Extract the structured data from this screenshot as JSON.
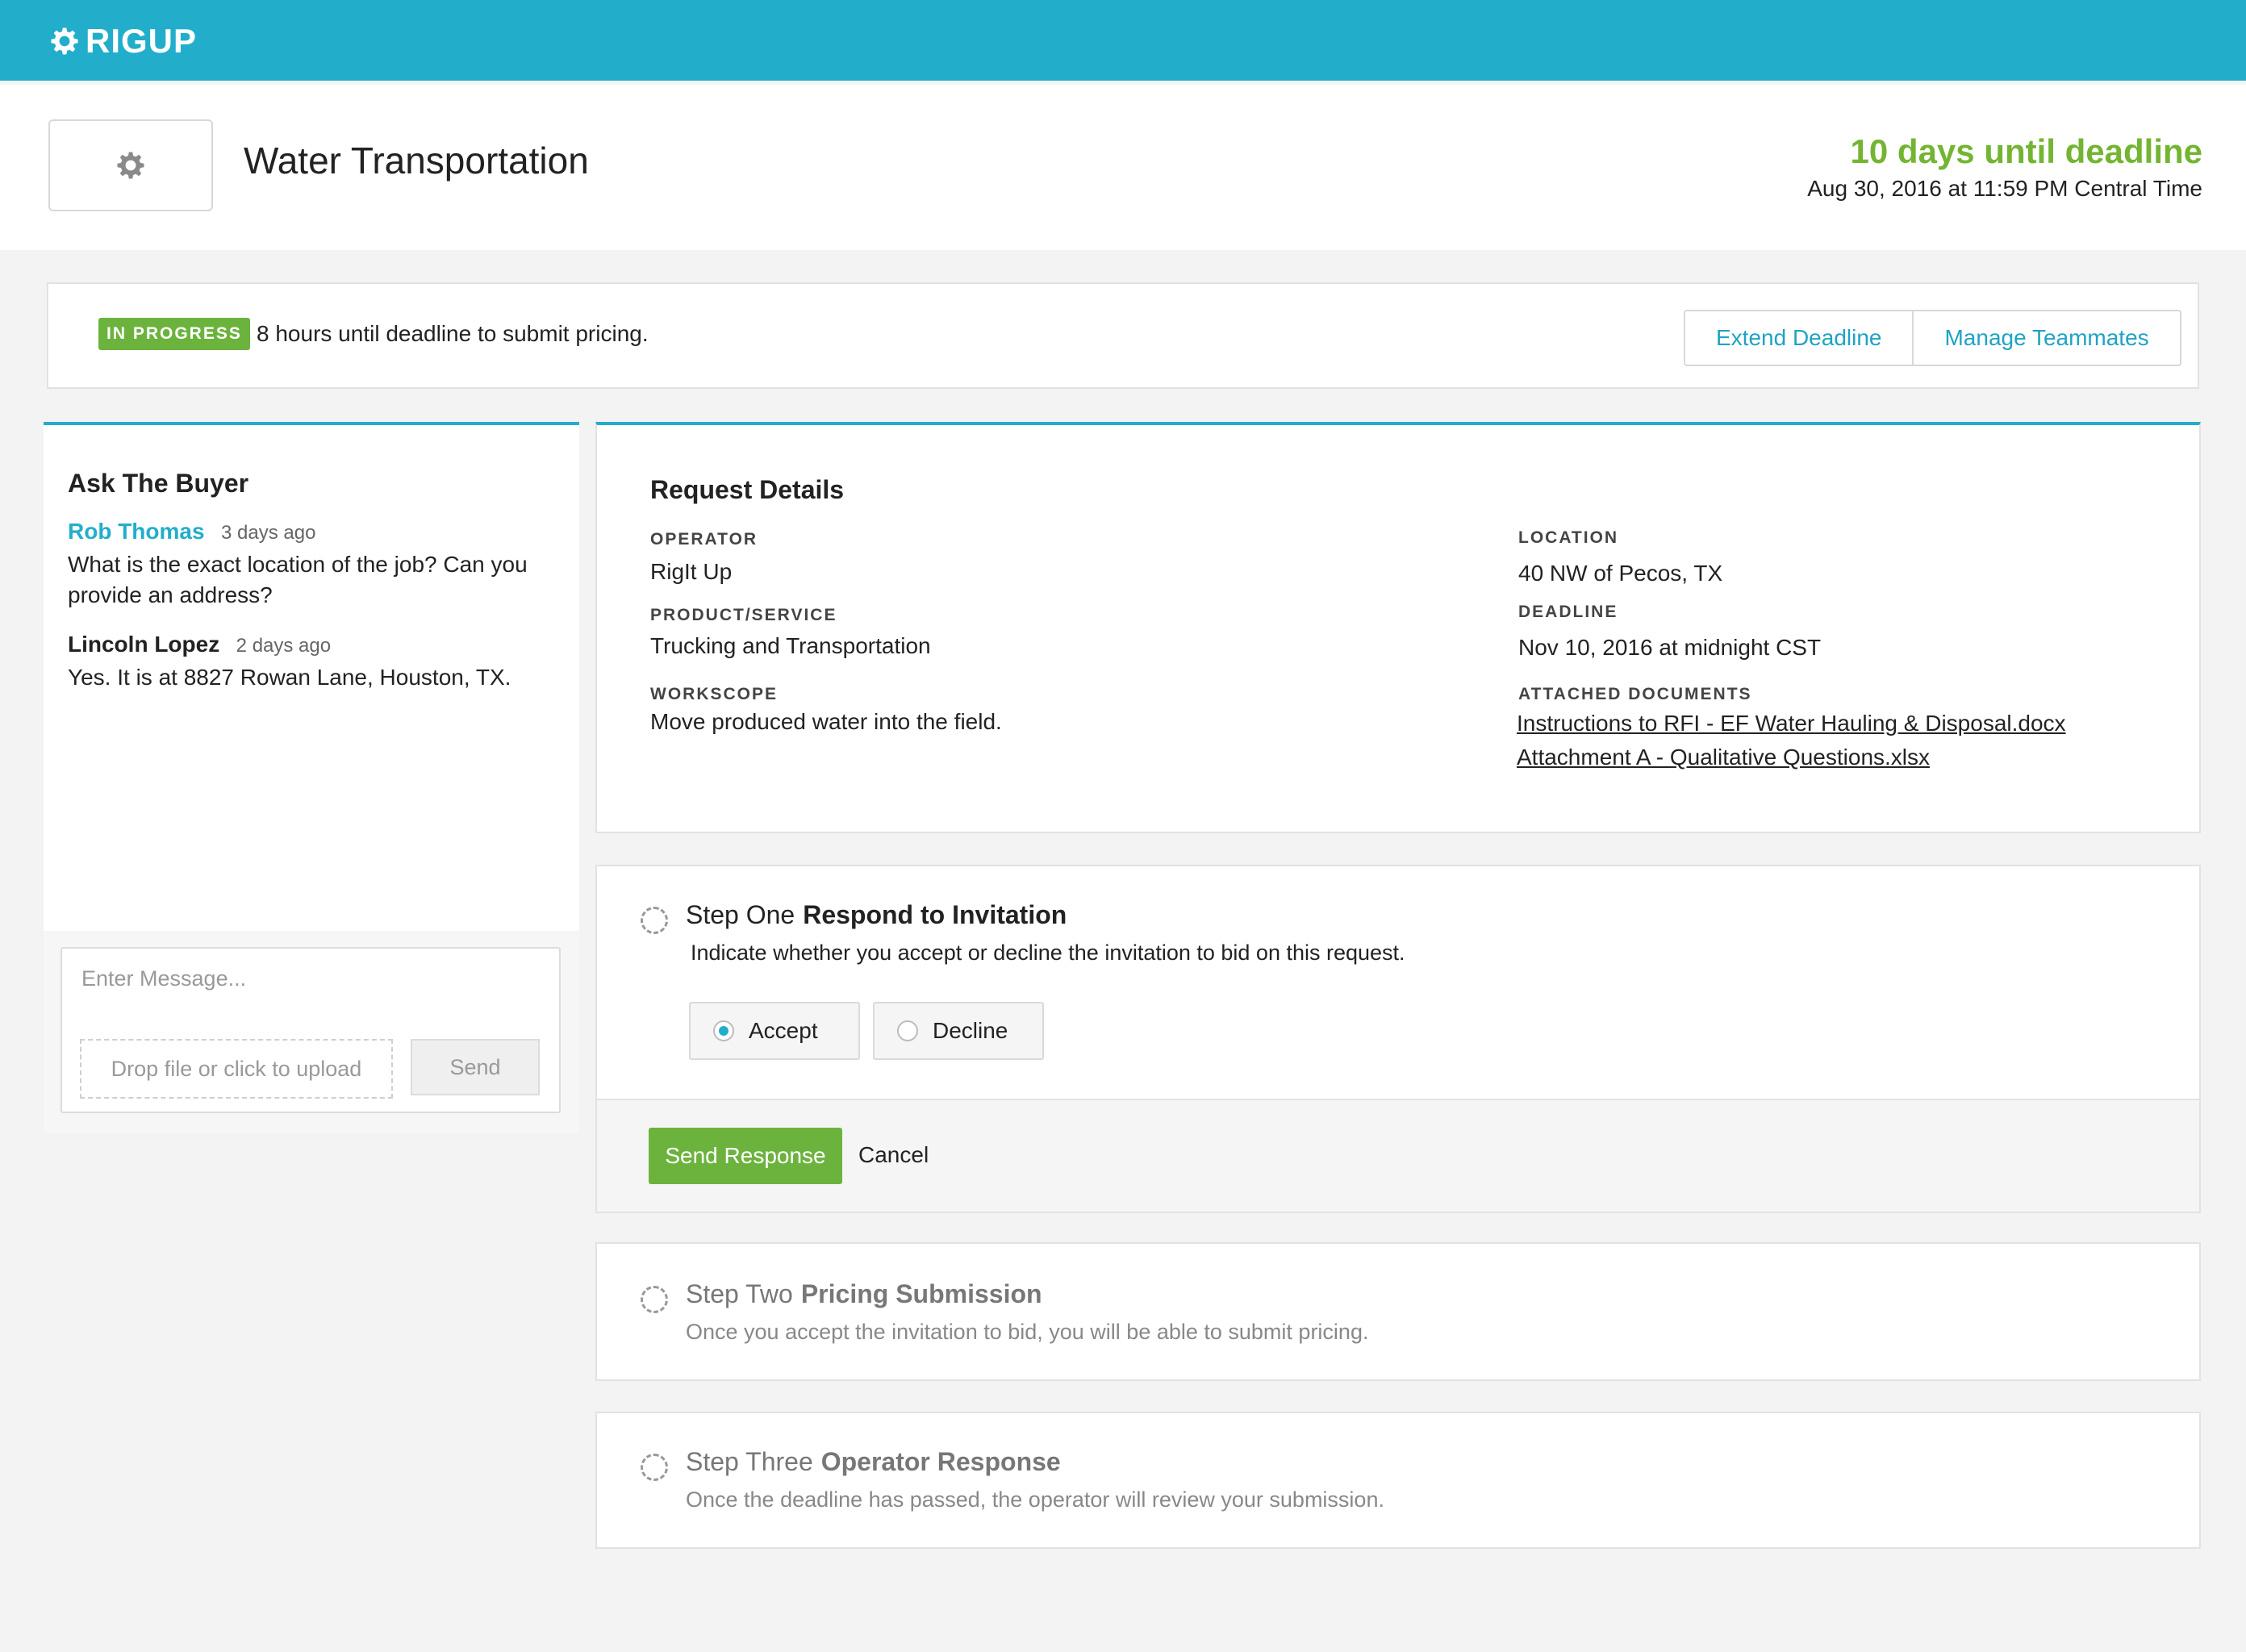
{
  "app": {
    "brand": "RIGUP",
    "accent_color": "#22aecb",
    "success_color": "#6cb33e"
  },
  "header": {
    "title": "Water Transportation",
    "deadline_countdown": "10 days until deadline",
    "deadline_datetime": "Aug 30, 2016 at 11:59 PM Central Time"
  },
  "status": {
    "badge": "IN PROGRESS",
    "message": "8 hours until deadline to submit pricing.",
    "extend_label": "Extend Deadline",
    "teammates_label": "Manage Teammates"
  },
  "ask": {
    "title": "Ask The Buyer",
    "messages": [
      {
        "author": "Rob Thomas",
        "time": "3 days ago",
        "text": "What is the exact location of the job? Can you provide an address?"
      },
      {
        "author": "Lincoln Lopez",
        "time": "2 days ago",
        "text": "Yes. It is at 8827 Rowan Lane, Houston, TX."
      }
    ],
    "input_placeholder": "Enter Message...",
    "upload_label": "Drop file or click to upload",
    "send_label": "Send"
  },
  "details": {
    "title": "Request Details",
    "operator_label": "OPERATOR",
    "operator": "RigIt Up",
    "product_label": "PRODUCT/SERVICE",
    "product": "Trucking and Transportation",
    "workscope_label": "WORKSCOPE",
    "workscope": "Move produced water into the field.",
    "location_label": "LOCATION",
    "location": "40 NW of Pecos, TX",
    "deadline_label": "DEADLINE",
    "deadline": "Nov 10, 2016 at midnight CST",
    "documents_label": "ATTACHED DOCUMENTS",
    "documents": [
      "Instructions to RFI - EF Water Hauling & Disposal.docx",
      "Attachment A - Qualitative Questions.xlsx"
    ]
  },
  "steps": [
    {
      "prefix": "Step One",
      "name": "Respond to Invitation",
      "description": "Indicate whether you accept or decline the invitation to bid on this request.",
      "options": [
        "Accept",
        "Decline"
      ],
      "selected": "Accept",
      "primary_label": "Send Response",
      "cancel_label": "Cancel"
    },
    {
      "prefix": "Step Two",
      "name": "Pricing Submission",
      "description": "Once you accept the invitation to bid, you will be able to submit pricing."
    },
    {
      "prefix": "Step Three",
      "name": "Operator Response",
      "description": "Once the deadline has passed, the operator will review your submission."
    }
  ]
}
